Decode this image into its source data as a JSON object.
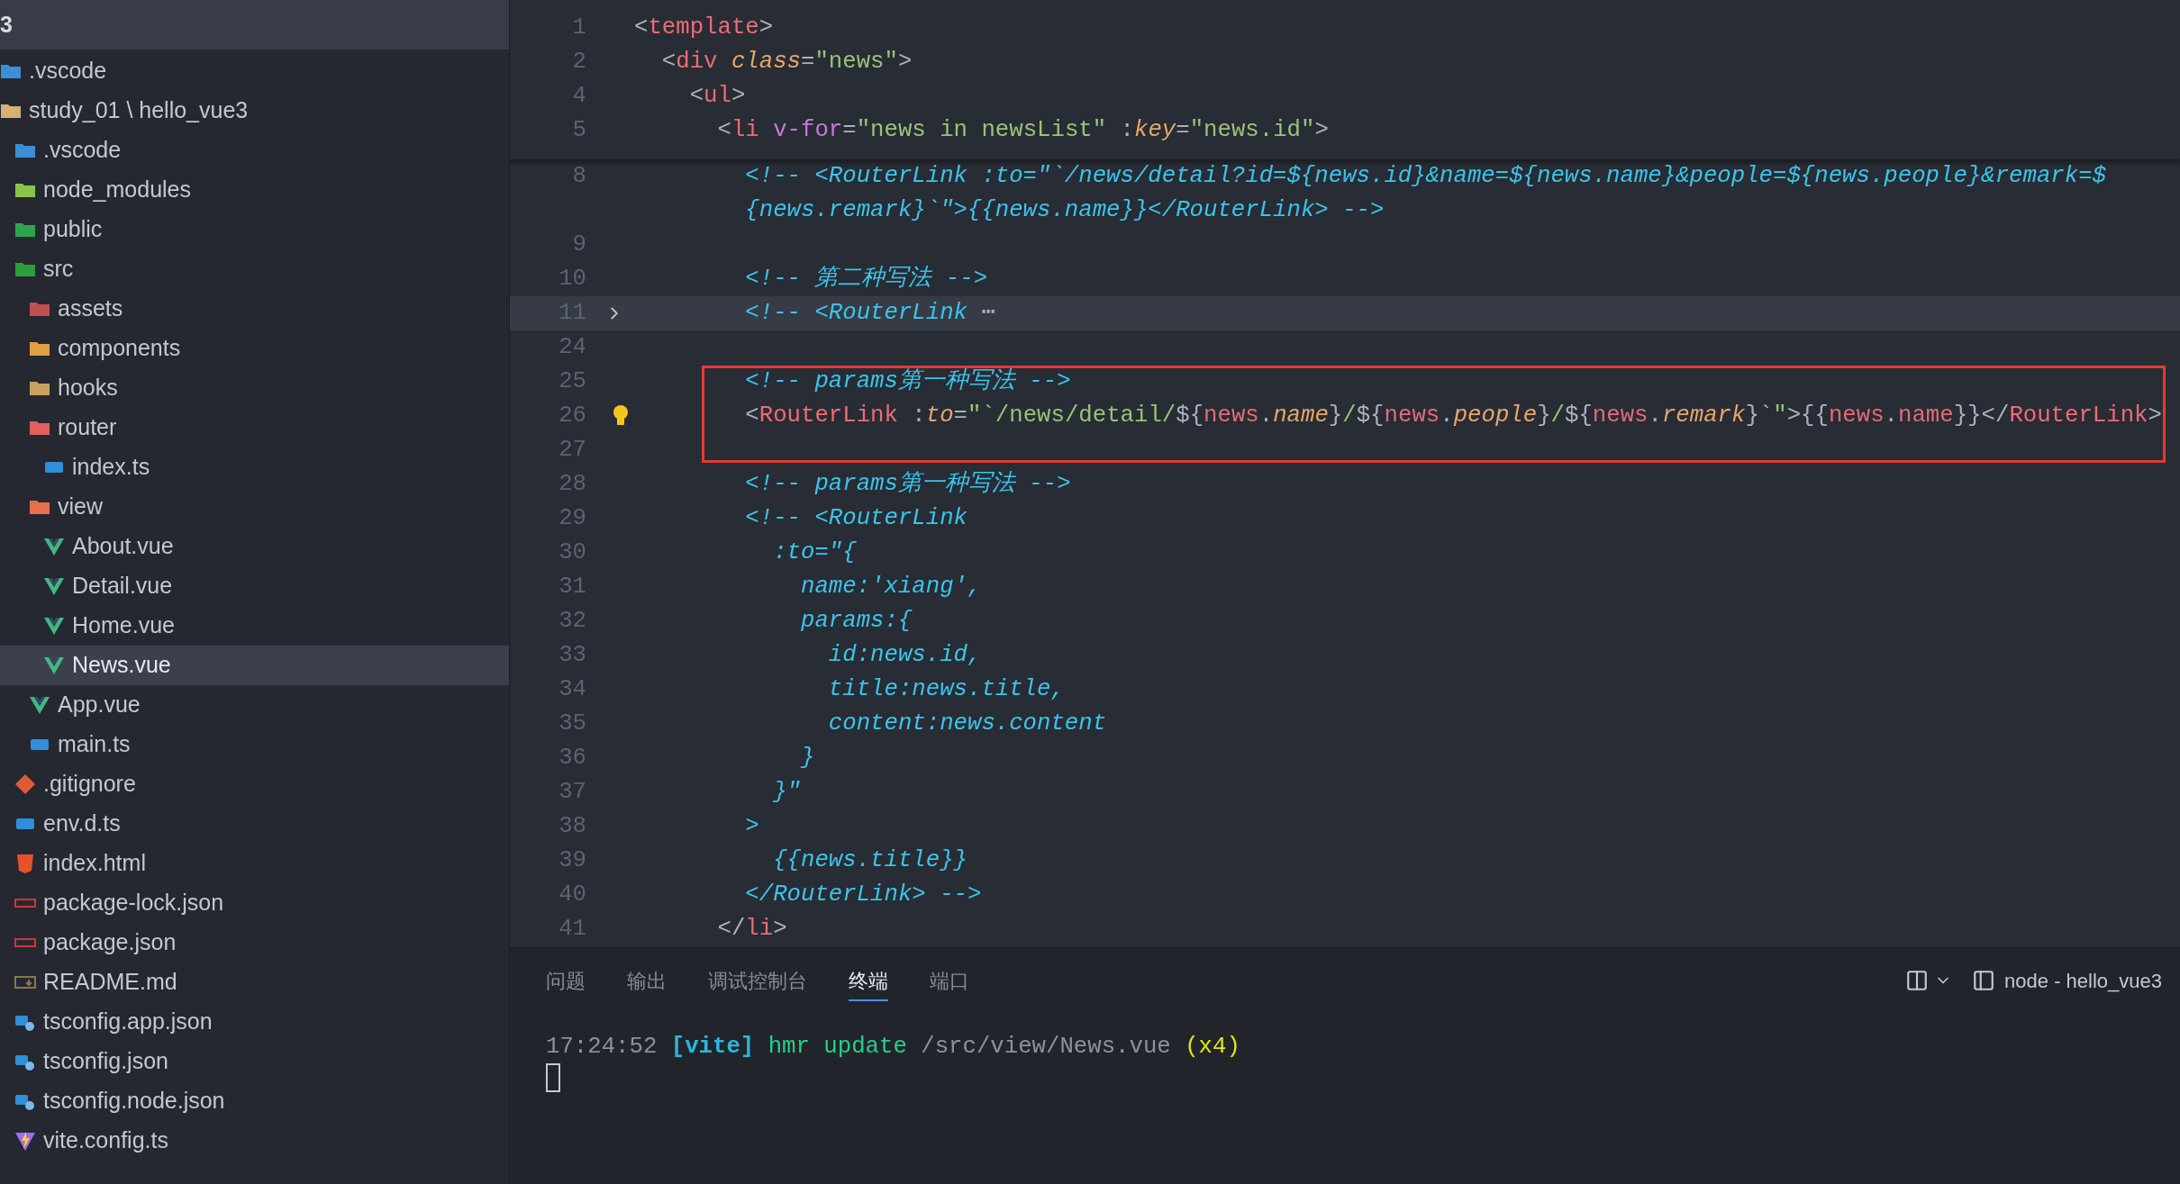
{
  "explorer": {
    "header": "3",
    "items": [
      {
        "name": ".vscode",
        "kind": "folder",
        "color": "#3b8fd8",
        "selected": false
      },
      {
        "name": "study_01 \\ hello_vue3",
        "kind": "folder",
        "color": "#d7b072",
        "selected": false,
        "children": [
          {
            "name": ".vscode",
            "kind": "folder",
            "color": "#3b8fd8",
            "selected": false
          },
          {
            "name": "node_modules",
            "kind": "folder",
            "color": "#8bc34a",
            "selected": false
          },
          {
            "name": "public",
            "kind": "folder",
            "color": "#2ea44f",
            "selected": false
          },
          {
            "name": "src",
            "kind": "folder",
            "color": "#2e9e3a",
            "selected": false,
            "children": [
              {
                "name": "assets",
                "kind": "folder",
                "color": "#c0504d",
                "selected": false
              },
              {
                "name": "components",
                "kind": "folder",
                "color": "#e0a040",
                "selected": false
              },
              {
                "name": "hooks",
                "kind": "folder",
                "color": "#c8a060",
                "selected": false
              },
              {
                "name": "router",
                "kind": "folder",
                "color": "#e06060",
                "selected": false,
                "children": [
                  {
                    "name": "index.ts",
                    "kind": "ts",
                    "selected": false
                  }
                ]
              },
              {
                "name": "view",
                "kind": "folder",
                "color": "#e8704a",
                "selected": false,
                "children": [
                  {
                    "name": "About.vue",
                    "kind": "vue",
                    "selected": false
                  },
                  {
                    "name": "Detail.vue",
                    "kind": "vue",
                    "selected": false
                  },
                  {
                    "name": "Home.vue",
                    "kind": "vue",
                    "selected": false
                  },
                  {
                    "name": "News.vue",
                    "kind": "vue",
                    "selected": true
                  }
                ]
              },
              {
                "name": "App.vue",
                "kind": "vue",
                "selected": false
              },
              {
                "name": "main.ts",
                "kind": "ts",
                "selected": false
              }
            ]
          },
          {
            "name": ".gitignore",
            "kind": "git",
            "selected": false
          },
          {
            "name": "env.d.ts",
            "kind": "ts",
            "selected": false
          },
          {
            "name": "index.html",
            "kind": "html",
            "selected": false
          },
          {
            "name": "package-lock.json",
            "kind": "npm",
            "selected": false
          },
          {
            "name": "package.json",
            "kind": "npm",
            "selected": false
          },
          {
            "name": "README.md",
            "kind": "markdown",
            "selected": false
          },
          {
            "name": "tsconfig.app.json",
            "kind": "tsconfig",
            "selected": false
          },
          {
            "name": "tsconfig.json",
            "kind": "tsconfig",
            "selected": false
          },
          {
            "name": "tsconfig.node.json",
            "kind": "tsconfig",
            "selected": false
          },
          {
            "name": "vite.config.ts",
            "kind": "vite",
            "selected": false
          }
        ]
      }
    ]
  },
  "editor": {
    "sticky_lines": [
      {
        "number": "1",
        "tokens": [
          {
            "text": "<",
            "kind": "punct"
          },
          {
            "text": "template",
            "kind": "tag"
          },
          {
            "text": ">",
            "kind": "punct"
          }
        ]
      },
      {
        "number": "2",
        "tokens": [
          {
            "text": "  <",
            "kind": "punct"
          },
          {
            "text": "div",
            "kind": "tag"
          },
          {
            "text": " class",
            "kind": "attr"
          },
          {
            "text": "=",
            "kind": "punct"
          },
          {
            "text": "\"news\"",
            "kind": "string"
          },
          {
            "text": ">",
            "kind": "punct"
          }
        ]
      },
      {
        "number": "4",
        "tokens": [
          {
            "text": "    <",
            "kind": "punct"
          },
          {
            "text": "ul",
            "kind": "tag"
          },
          {
            "text": ">",
            "kind": "punct"
          }
        ]
      },
      {
        "number": "5",
        "tokens": [
          {
            "text": "      <",
            "kind": "punct"
          },
          {
            "text": "li",
            "kind": "tag"
          },
          {
            "text": " v-for",
            "kind": "directive"
          },
          {
            "text": "=",
            "kind": "punct"
          },
          {
            "text": "\"news in newsList\"",
            "kind": "string"
          },
          {
            "text": " :",
            "kind": "punct"
          },
          {
            "text": "key",
            "kind": "attr"
          },
          {
            "text": "=",
            "kind": "punct"
          },
          {
            "text": "\"news.id\"",
            "kind": "string"
          },
          {
            "text": ">",
            "kind": "punct"
          }
        ]
      }
    ],
    "lines": [
      {
        "number": "8",
        "folded": false,
        "bulb": false,
        "boxed": false,
        "tokens": [
          {
            "text": "        <!-- <RouterLink :to=\"`/news/detail?id=${news.id}&name=${news.name}&people=${news.people}&remark=$",
            "kind": "comment"
          }
        ],
        "wrap_tokens": [
          {
            "text": "        {news.remark}`\">{{news.name}}</RouterLink> -->",
            "kind": "comment"
          }
        ]
      },
      {
        "number": "9",
        "folded": false,
        "bulb": false,
        "boxed": false
      },
      {
        "number": "10",
        "folded": false,
        "bulb": false,
        "boxed": false,
        "tokens": [
          {
            "text": "        <!-- 第二种写法 -->",
            "kind": "comment"
          }
        ]
      },
      {
        "number": "11",
        "folded": true,
        "bulb": false,
        "boxed": false,
        "tokens": [
          {
            "text": "        <!-- <RouterLink",
            "kind": "comment"
          },
          {
            "text": " ⋯",
            "kind": "punct"
          }
        ]
      },
      {
        "number": "24",
        "folded": false,
        "bulb": false,
        "boxed": false
      },
      {
        "number": "25",
        "folded": false,
        "bulb": false,
        "boxed": true,
        "tokens": [
          {
            "text": "        <!-- params第一种写法 -->",
            "kind": "comment"
          }
        ]
      },
      {
        "number": "26",
        "folded": false,
        "bulb": true,
        "boxed": true,
        "tokens": [
          {
            "text": "        <",
            "kind": "punct"
          },
          {
            "text": "RouterLink",
            "kind": "tag"
          },
          {
            "text": " :",
            "kind": "punct"
          },
          {
            "text": "to",
            "kind": "attr"
          },
          {
            "text": "=",
            "kind": "punct"
          },
          {
            "text": "\"`/news/detail/",
            "kind": "string"
          },
          {
            "text": "${",
            "kind": "punct"
          },
          {
            "text": "news",
            "kind": "var"
          },
          {
            "text": ".",
            "kind": "punct"
          },
          {
            "text": "name",
            "kind": "attr"
          },
          {
            "text": "}",
            "kind": "punct"
          },
          {
            "text": "/",
            "kind": "string"
          },
          {
            "text": "${",
            "kind": "punct"
          },
          {
            "text": "news",
            "kind": "var"
          },
          {
            "text": ".",
            "kind": "punct"
          },
          {
            "text": "people",
            "kind": "attr"
          },
          {
            "text": "}",
            "kind": "punct"
          },
          {
            "text": "/",
            "kind": "string"
          },
          {
            "text": "${",
            "kind": "punct"
          },
          {
            "text": "news",
            "kind": "var"
          },
          {
            "text": ".",
            "kind": "punct"
          },
          {
            "text": "remark",
            "kind": "attr"
          },
          {
            "text": "}",
            "kind": "punct"
          },
          {
            "text": "`\"",
            "kind": "string"
          },
          {
            "text": ">{{",
            "kind": "punct"
          },
          {
            "text": "news",
            "kind": "var"
          },
          {
            "text": ".",
            "kind": "punct"
          },
          {
            "text": "name",
            "kind": "var"
          },
          {
            "text": "}}</",
            "kind": "punct"
          },
          {
            "text": "RouterLink",
            "kind": "tag"
          },
          {
            "text": ">",
            "kind": "punct"
          }
        ]
      },
      {
        "number": "27",
        "folded": false,
        "bulb": false,
        "boxed": true
      },
      {
        "number": "28",
        "folded": false,
        "bulb": false,
        "boxed": false,
        "tokens": [
          {
            "text": "        <!-- params第一种写法 -->",
            "kind": "comment"
          }
        ]
      },
      {
        "number": "29",
        "folded": false,
        "bulb": false,
        "boxed": false,
        "tokens": [
          {
            "text": "        <!-- <RouterLink",
            "kind": "comment"
          }
        ]
      },
      {
        "number": "30",
        "folded": false,
        "bulb": false,
        "boxed": false,
        "tokens": [
          {
            "text": "          :to=\"{",
            "kind": "comment"
          }
        ]
      },
      {
        "number": "31",
        "folded": false,
        "bulb": false,
        "boxed": false,
        "tokens": [
          {
            "text": "            name:'xiang',",
            "kind": "comment"
          }
        ]
      },
      {
        "number": "32",
        "folded": false,
        "bulb": false,
        "boxed": false,
        "tokens": [
          {
            "text": "            params:{",
            "kind": "comment"
          }
        ]
      },
      {
        "number": "33",
        "folded": false,
        "bulb": false,
        "boxed": false,
        "tokens": [
          {
            "text": "              id:news.id,",
            "kind": "comment"
          }
        ]
      },
      {
        "number": "34",
        "folded": false,
        "bulb": false,
        "boxed": false,
        "tokens": [
          {
            "text": "              title:news.title,",
            "kind": "comment"
          }
        ]
      },
      {
        "number": "35",
        "folded": false,
        "bulb": false,
        "boxed": false,
        "tokens": [
          {
            "text": "              content:news.content",
            "kind": "comment"
          }
        ]
      },
      {
        "number": "36",
        "folded": false,
        "bulb": false,
        "boxed": false,
        "tokens": [
          {
            "text": "            }",
            "kind": "comment"
          }
        ]
      },
      {
        "number": "37",
        "folded": false,
        "bulb": false,
        "boxed": false,
        "tokens": [
          {
            "text": "          }\"",
            "kind": "comment"
          }
        ]
      },
      {
        "number": "38",
        "folded": false,
        "bulb": false,
        "boxed": false,
        "tokens": [
          {
            "text": "        >",
            "kind": "comment"
          }
        ]
      },
      {
        "number": "39",
        "folded": false,
        "bulb": false,
        "boxed": false,
        "tokens": [
          {
            "text": "          {{news.title}}",
            "kind": "comment"
          }
        ]
      },
      {
        "number": "40",
        "folded": false,
        "bulb": false,
        "boxed": false,
        "tokens": [
          {
            "text": "        </RouterLink> -->",
            "kind": "comment"
          }
        ]
      },
      {
        "number": "41",
        "folded": false,
        "bulb": false,
        "boxed": false,
        "tokens": [
          {
            "text": "      </",
            "kind": "punct"
          },
          {
            "text": "li",
            "kind": "tag"
          },
          {
            "text": ">",
            "kind": "punct"
          }
        ]
      }
    ]
  },
  "panel": {
    "tabs": [
      {
        "label": "问题",
        "selected": false
      },
      {
        "label": "输出",
        "selected": false
      },
      {
        "label": "调试控制台",
        "selected": false
      },
      {
        "label": "终端",
        "selected": true
      },
      {
        "label": "端口",
        "selected": false
      }
    ],
    "terminal_title": "node - hello_vue3",
    "terminal_tokens": [
      {
        "text": "17:24:52 ",
        "kind": "time"
      },
      {
        "text": "[vite]",
        "kind": "source"
      },
      {
        "text": " hmr update",
        "kind": "action"
      },
      {
        "text": " /src/view/News.vue",
        "kind": "path"
      },
      {
        "text": " (x4)",
        "kind": "count"
      }
    ]
  }
}
